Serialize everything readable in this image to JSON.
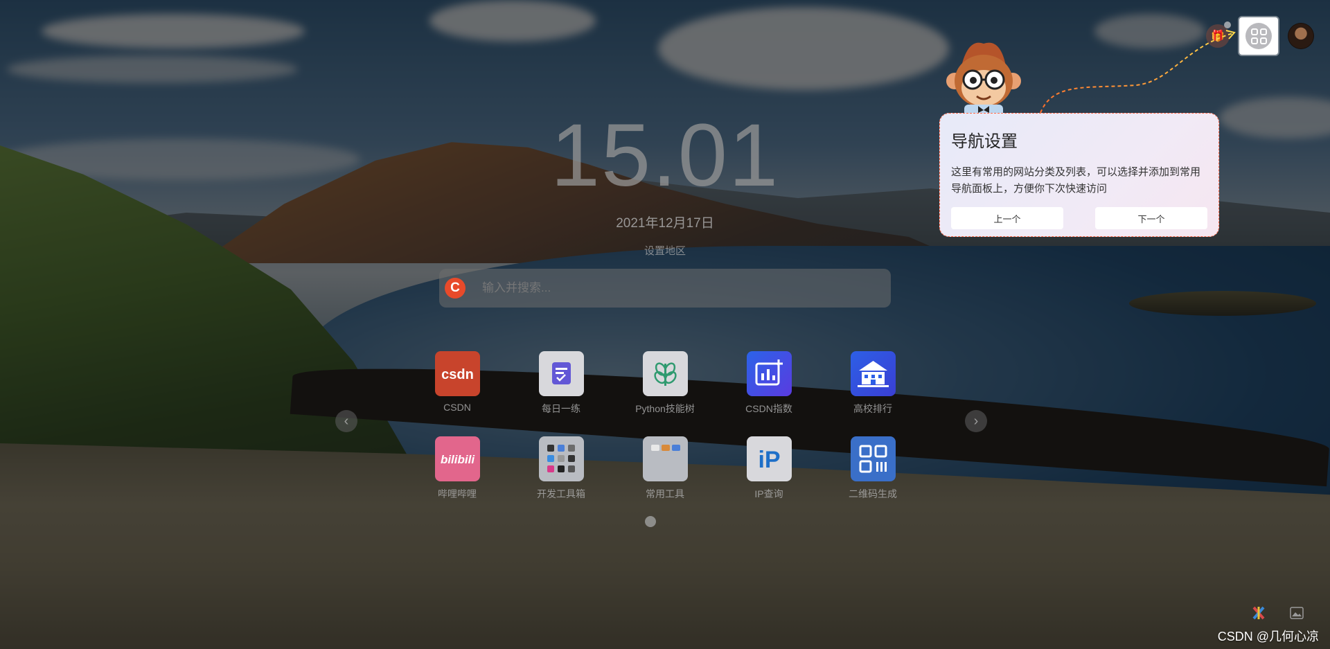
{
  "clock": {
    "time": "15.01",
    "date": "2021年12月17日",
    "region_link": "设置地区"
  },
  "search": {
    "placeholder": "输入并搜索...",
    "engine_icon": "C"
  },
  "guide": {
    "title": "导航设置",
    "description": "这里有常用的网站分类及列表，可以选择并添加到常用导航面板上，方便你下次快速访问",
    "prev_label": "上一个",
    "next_label": "下一个",
    "border_color": "#ff6b4a"
  },
  "apps": {
    "rows": [
      [
        {
          "label": "CSDN",
          "icon": "csdn-logo-icon",
          "color": "#e0432a"
        },
        {
          "label": "每日一练",
          "icon": "daily-practice-icon",
          "color": "#6f5de0"
        },
        {
          "label": "Python技能树",
          "icon": "skill-tree-icon",
          "color": "#3aa981"
        },
        {
          "label": "CSDN指数",
          "icon": "csdn-index-icon",
          "color": "#3b7cf5"
        },
        {
          "label": "高校排行",
          "icon": "university-ranking-icon",
          "color": "#2c5de5"
        }
      ],
      [
        {
          "label": "哔哩哔哩",
          "icon": "bilibili-icon",
          "color": "#fb7299",
          "text": "bilibili"
        },
        {
          "label": "开发工具箱",
          "icon": "dev-toolbox-icon",
          "color": "#c8ccd4"
        },
        {
          "label": "常用工具",
          "icon": "common-tools-icon",
          "color": "#c8ccd4"
        },
        {
          "label": "IP查询",
          "icon": "ip-lookup-icon",
          "color": "#1e7fd8",
          "text": "iP"
        },
        {
          "label": "二维码生成",
          "icon": "qr-code-icon",
          "color": "#3a7ee0"
        }
      ]
    ]
  },
  "pager": {
    "prev_icon": "‹",
    "next_icon": "›"
  },
  "watermark": "CSDN @几何心凉",
  "colors": {
    "accent": "#e84a2a",
    "overlay": "rgba(0,0,0,0.55)"
  }
}
